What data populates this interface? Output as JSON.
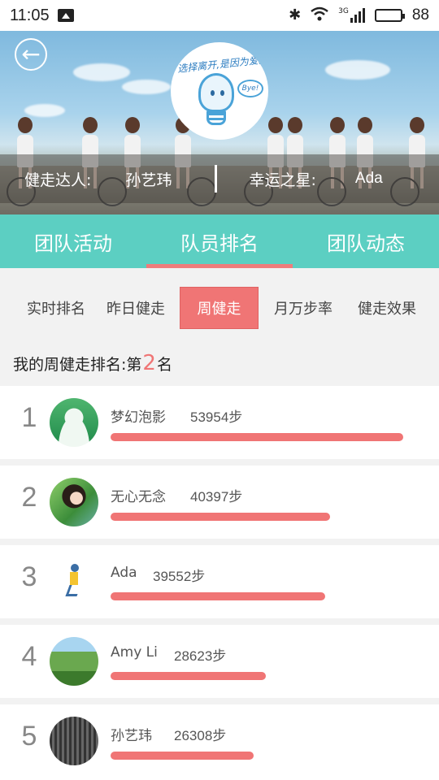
{
  "status_bar": {
    "time": "11:05",
    "battery": "88",
    "network": "3G"
  },
  "header": {
    "back_label": "←",
    "logo_text": "选择离开,是因为爱。",
    "logo_bubble": "Bye!",
    "info_left_label": "健走达人:",
    "info_left_value": "孙艺玮",
    "info_right_label": "幸运之星:",
    "info_right_value": "Ada"
  },
  "tabs": [
    {
      "label": "团队活动",
      "active": false
    },
    {
      "label": "队员排名",
      "active": true
    },
    {
      "label": "团队动态",
      "active": false
    }
  ],
  "sub_tabs": [
    {
      "label": "实时排名",
      "active": false
    },
    {
      "label": "昨日健走",
      "active": false
    },
    {
      "label": "周健走",
      "active": true
    },
    {
      "label": "月万步率",
      "active": false
    },
    {
      "label": "健走效果",
      "active": false
    }
  ],
  "my_rank": {
    "prefix": "我的周健走排名:第",
    "number": "2",
    "suffix": "名"
  },
  "rankings": [
    {
      "rank": "1",
      "name": "梦幻泡影",
      "steps": "53954步",
      "progress": 1.0,
      "avatar": "silhouette-avatar"
    },
    {
      "rank": "2",
      "name": "无心无念",
      "steps": "40397步",
      "progress": 0.749,
      "avatar": "girl-photo-avatar"
    },
    {
      "rank": "3",
      "name": "Ada",
      "steps": "39552步",
      "progress": 0.733,
      "avatar": "runner-avatar"
    },
    {
      "rank": "4",
      "name": "Amy Li",
      "steps": "28623步",
      "progress": 0.53,
      "avatar": "landscape-avatar"
    },
    {
      "rank": "5",
      "name": "孙艺玮",
      "steps": "26308步",
      "progress": 0.488,
      "avatar": "calligraphy-avatar"
    }
  ],
  "colors": {
    "accent": "#5ccfc2",
    "highlight": "#f07575"
  }
}
